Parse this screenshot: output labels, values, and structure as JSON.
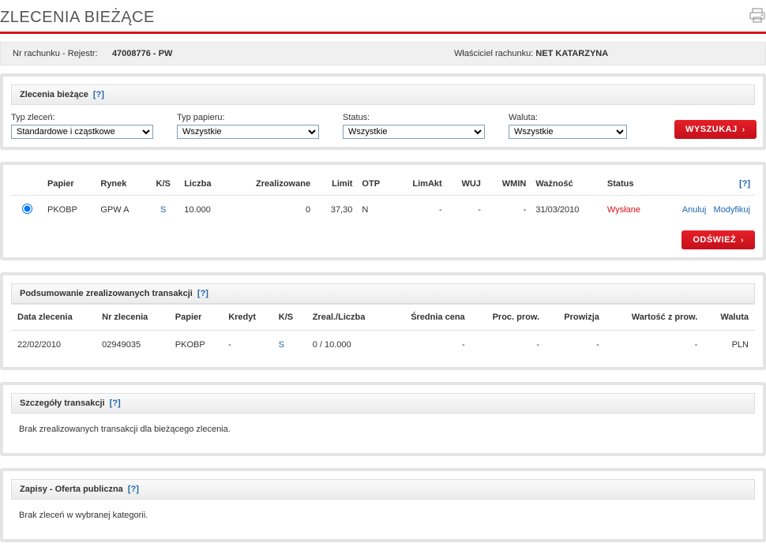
{
  "page": {
    "title": "ZLECENIA BIEŻĄCE"
  },
  "account": {
    "nr_label": "Nr rachunku - Rejestr:",
    "nr_value": "47008776 - PW",
    "owner_label": "Właściciel rachunku:",
    "owner_value": "NET KATARZYNA"
  },
  "filters": {
    "section_title": "Zlecenia bieżące",
    "help": "[?]",
    "typ_zlecen_label": "Typ zleceń:",
    "typ_zlecen_value": "Standardowe i cząstkowe",
    "typ_papieru_label": "Typ papieru:",
    "typ_papieru_value": "Wszystkie",
    "status_label": "Status:",
    "status_value": "Wszystkie",
    "waluta_label": "Waluta:",
    "waluta_value": "Wszystkie",
    "search_btn": "WYSZUKAJ"
  },
  "orders": {
    "help": "[?]",
    "headers": {
      "papier": "Papier",
      "rynek": "Rynek",
      "ks": "K/S",
      "liczba": "Liczba",
      "zrealizowane": "Zrealizowane",
      "limit": "Limit",
      "otp": "OTP",
      "limakt": "LimAkt",
      "wuj": "WUJ",
      "wmin": "WMIN",
      "waznosc": "Ważność",
      "status": "Status"
    },
    "row": {
      "papier": "PKOBP",
      "rynek": "GPW A",
      "ks": "S",
      "liczba": "10.000",
      "zrealizowane": "0",
      "limit": "37,30",
      "otp": "N",
      "limakt": "-",
      "wuj": "-",
      "wmin": "-",
      "waznosc": "31/03/2010",
      "status": "Wysłane",
      "anuluj": "Anuluj",
      "modyfikuj": "Modyfikuj"
    },
    "refresh_btn": "ODŚWIEŻ"
  },
  "summary": {
    "section_title": "Podsumowanie zrealizowanych transakcji",
    "help": "[?]",
    "headers": {
      "data": "Data zlecenia",
      "nr": "Nr zlecenia",
      "papier": "Papier",
      "kredyt": "Kredyt",
      "ks": "K/S",
      "zreal": "Zreal./Liczba",
      "cena": "Średnia cena",
      "proc": "Proc. prow.",
      "prowizja": "Prowizja",
      "wartosc": "Wartość z prow.",
      "waluta": "Waluta"
    },
    "row": {
      "data": "22/02/2010",
      "nr": "02949035",
      "papier": "PKOBP",
      "kredyt": "-",
      "ks": "S",
      "zreal": "0 / 10.000",
      "cena": "-",
      "proc": "-",
      "prowizja": "-",
      "wartosc": "-",
      "waluta": "PLN"
    }
  },
  "details": {
    "section_title": "Szczegóły transakcji",
    "help": "[?]",
    "body": "Brak zrealizowanych transakcji dla bieżącego zlecenia."
  },
  "zapisy": {
    "section_title": "Zapisy - Oferta publiczna",
    "help": "[?]",
    "body": "Brak zleceń w wybranej kategorii."
  }
}
